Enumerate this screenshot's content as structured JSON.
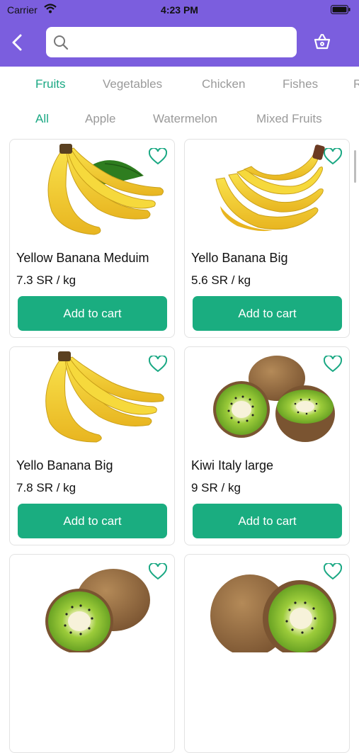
{
  "status_bar": {
    "carrier": "Carrier",
    "time": "4:23 PM"
  },
  "search": {
    "placeholder": "",
    "value": ""
  },
  "categories": [
    {
      "label": "Fruits",
      "active": true
    },
    {
      "label": "Vegetables",
      "active": false
    },
    {
      "label": "Chicken",
      "active": false
    },
    {
      "label": "Fishes",
      "active": false
    },
    {
      "label": "R",
      "active": false
    }
  ],
  "subcategories": [
    {
      "label": "All",
      "active": true
    },
    {
      "label": "Apple",
      "active": false
    },
    {
      "label": "Watermelon",
      "active": false
    },
    {
      "label": "Mixed Fruits",
      "active": false
    }
  ],
  "products": [
    {
      "name": "Yellow Banana Meduim",
      "price": "7.3 SR / kg",
      "button": "Add to cart",
      "image": "banana-bunch-with-leaf"
    },
    {
      "name": "Yello Banana Big",
      "price": "5.6 SR / kg",
      "button": "Add to cart",
      "image": "banana-bunch"
    },
    {
      "name": "Yello Banana Big",
      "price": "7.8 SR / kg",
      "button": "Add to cart",
      "image": "banana-bunch"
    },
    {
      "name": "Kiwi Italy large",
      "price": "9 SR / kg",
      "button": "Add to cart",
      "image": "kiwi"
    },
    {
      "name": "",
      "price": "",
      "button": "",
      "image": "kiwi"
    },
    {
      "name": "",
      "price": "",
      "button": "",
      "image": "kiwi"
    }
  ],
  "colors": {
    "header": "#7b5ede",
    "accent": "#1aa883",
    "button": "#1aad80",
    "inactive_tab": "#9a9a9a"
  }
}
